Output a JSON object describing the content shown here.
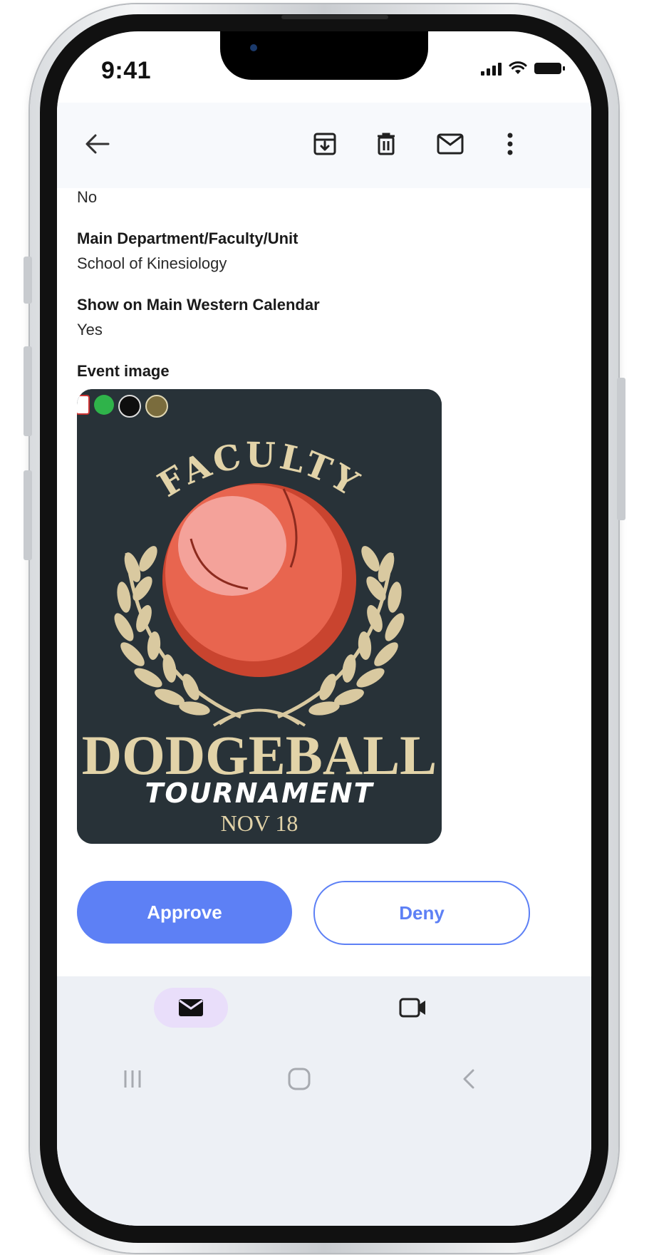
{
  "status_bar": {
    "time": "9:41"
  },
  "app_bar": {
    "icons": [
      "back-arrow-icon",
      "archive-icon",
      "delete-icon",
      "mail-icon",
      "more-vert-icon"
    ]
  },
  "fields": {
    "previous_value": "No",
    "department_label": "Main Department/Faculty/Unit",
    "department_value": "School of Kinesiology",
    "calendar_label": "Show on Main Western Calendar",
    "calendar_value": "Yes",
    "image_label": "Event image"
  },
  "event_image": {
    "top_text": "FACULTY",
    "title": "DODGEBALL",
    "subtitle": "TOURNAMENT",
    "date": "NOV 18"
  },
  "actions": {
    "approve_label": "Approve",
    "deny_label": "Deny"
  },
  "bottom_nav": {
    "items": [
      "mail-icon",
      "video-icon"
    ]
  },
  "colors": {
    "accent": "#5d80f5",
    "poster_bg": "#283238",
    "ball": "#e8654f",
    "wreath": "#d9c9a0"
  }
}
